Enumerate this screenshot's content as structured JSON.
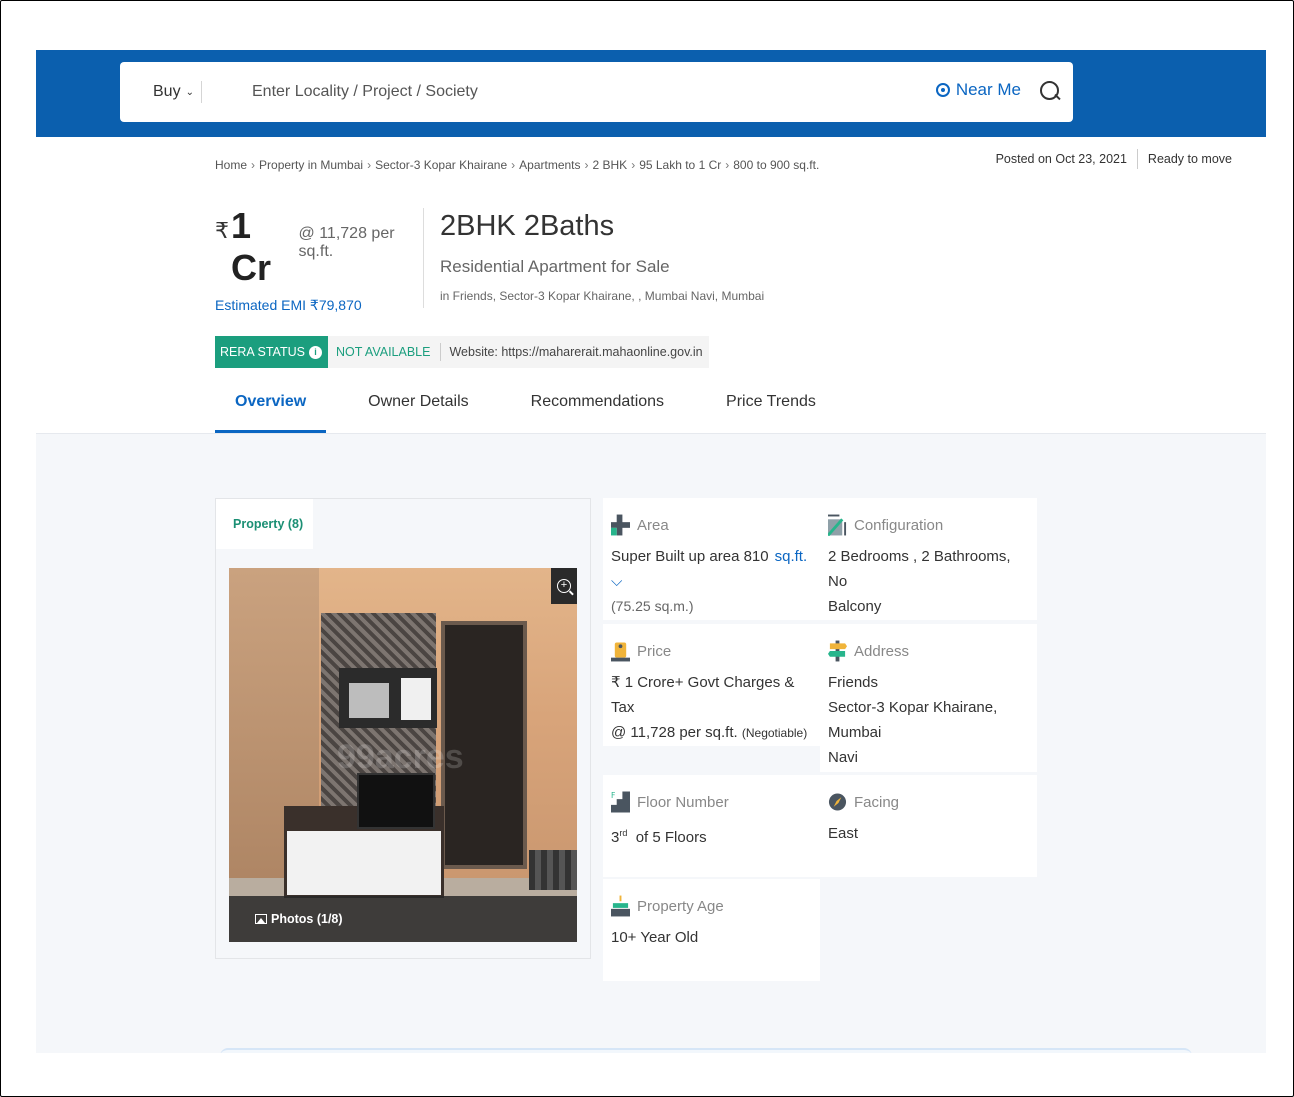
{
  "header": {
    "buy_label": "Buy",
    "search_placeholder": "Enter Locality / Project / Society",
    "near_me": "Near Me"
  },
  "breadcrumb": [
    "Home",
    "Property in Mumbai",
    "Sector-3 Kopar Khairane",
    "Apartments",
    "2 BHK",
    "95 Lakh to 1 Cr",
    "800 to 900 sq.ft."
  ],
  "posted": {
    "date": "Posted on Oct 23, 2021",
    "status": "Ready to move"
  },
  "price": {
    "symbol": "₹",
    "amount": "1 Cr",
    "per_sqft": "@ 11,728 per sq.ft.",
    "emi": "Estimated EMI ₹79,870"
  },
  "title": {
    "bhk": "2BHK 2Baths",
    "type": "Residential Apartment for Sale",
    "locality": "in Friends, Sector-3 Kopar Khairane, , Mumbai Navi, Mumbai"
  },
  "rera": {
    "label": "RERA STATUS",
    "status": "NOT AVAILABLE",
    "website": "Website: https://maharerait.mahaonline.gov.in"
  },
  "tabs": [
    "Overview",
    "Owner Details",
    "Recommendations",
    "Price Trends"
  ],
  "gallery": {
    "tab_label": "Property (8)",
    "photos_label": "Photos (1/8)",
    "watermark": "99acres"
  },
  "details": {
    "area": {
      "label": "Area",
      "value": "Super Built up area 810",
      "unit": "sq.ft.",
      "sub": "(75.25 sq.m.)"
    },
    "configuration": {
      "label": "Configuration",
      "value_line1": "2 Bedrooms , 2 Bathrooms, No",
      "value_line2": "Balcony"
    },
    "price": {
      "label": "Price",
      "value_line1": "₹ 1 Crore+ Govt Charges & Tax",
      "value_line2": "@ 11,728 per sq.ft.",
      "negotiable": "(Negotiable)"
    },
    "address": {
      "label": "Address",
      "line1": "Friends",
      "line2": "Sector-3 Kopar Khairane, Mumbai",
      "line3": "Navi"
    },
    "floor": {
      "label": "Floor Number",
      "floor": "3",
      "suffix": "rd",
      "total": "of 5 Floors"
    },
    "facing": {
      "label": "Facing",
      "value": "East"
    },
    "age": {
      "label": "Property Age",
      "value": "10+ Year Old"
    }
  },
  "colors": {
    "header_blue": "#0b5fae",
    "link_blue": "#0b66c2",
    "rera_green": "#1b9e7e"
  }
}
